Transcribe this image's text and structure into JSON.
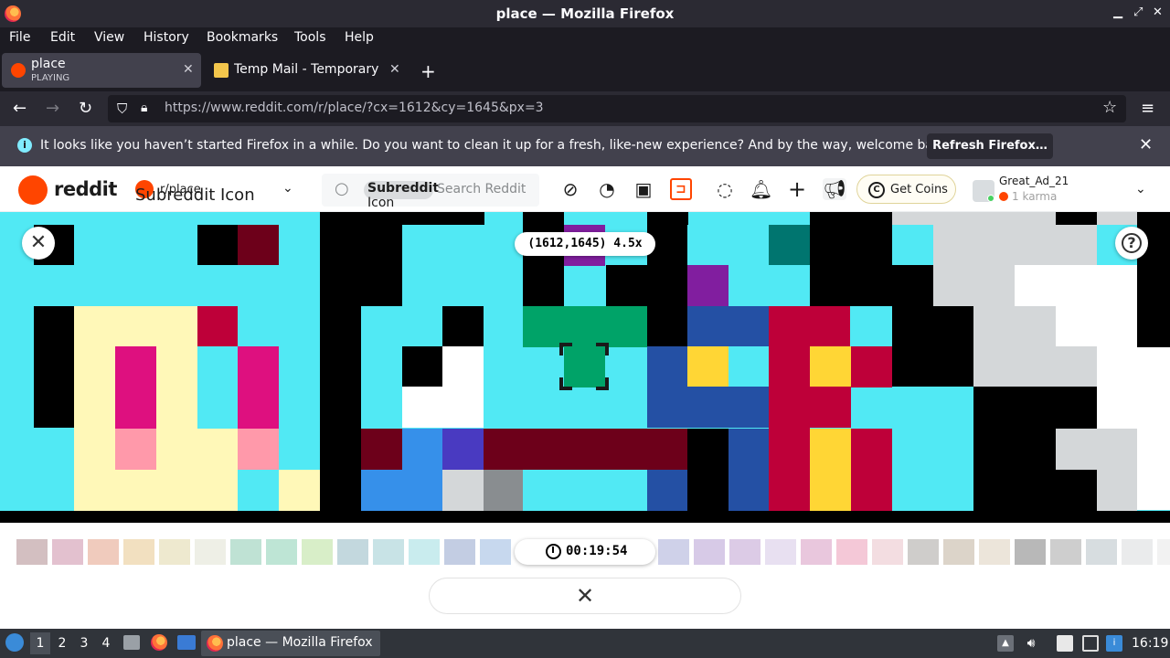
{
  "window": {
    "title": "place — Mozilla Firefox"
  },
  "menu": [
    "File",
    "Edit",
    "View",
    "History",
    "Bookmarks",
    "Tools",
    "Help"
  ],
  "tabs": [
    {
      "title": "place",
      "subtitle": "PLAYING"
    },
    {
      "title": "Temp Mail - Temporary D"
    }
  ],
  "navbar": {
    "url": "https://www.reddit.com/r/place/?cx=1612&cy=1645&px=3"
  },
  "notification": {
    "message": "It looks like you haven’t started Firefox in a while. Do you want to clean it up for a fresh, like-new experience? And by the way, welcome back!",
    "button": "Refresh Firefox…"
  },
  "reddit": {
    "logo_text": "reddit",
    "subreddit_icon_alt": "Subreddit Icon",
    "subreddit": "r/place",
    "search_chip": "Subreddit",
    "search_chip_line2": "Icon",
    "search_placeholder": "Search Reddit",
    "get_coins": "Get Coins",
    "username": "Great_Ad_21",
    "karma": "1 karma"
  },
  "place": {
    "coordinates": "(1612,1645) 4.5x",
    "timer": "00:19:54",
    "help_label": "?",
    "colors": {
      "cyan": "#51e9f4",
      "black": "#000000",
      "cream": "#fff8b8",
      "pink": "#de107f",
      "lightpink": "#ff99aa",
      "crimson": "#be0039",
      "maroon": "#6d001a",
      "green": "#00a368",
      "blue": "#2450a4",
      "brightblue": "#3690ea",
      "purple": "#811e9f",
      "indigo": "#493ac1",
      "yellow": "#ffd635",
      "white": "#ffffff",
      "lightgray": "#d4d7d9",
      "gray": "#898d90",
      "teal": "#00756f",
      "darkmagenta": "#6a1b50"
    },
    "palette": [
      "#d3bfc1",
      "#e3c1cf",
      "#f0cbbd",
      "#f2e0c0",
      "#eee9cf",
      "#eeefe6",
      "#bfe2d4",
      "#bee5d5",
      "#d8eec8",
      "#c3d8de",
      "#c8e3e6",
      "#c9ecee",
      "#c3cde3",
      "#c7d8ee",
      "#cfd1e9",
      "#d7cae7",
      "#dccbe6",
      "#e8e0f1",
      "#e9c7dd",
      "#f4c8d7",
      "#f3dde1",
      "#cfcdcb",
      "#dcd4c9",
      "#ece5da",
      "#b8b8b8",
      "#cecece",
      "#d7dde0",
      "#eaebec",
      "#f2f2f2"
    ]
  },
  "taskbar": {
    "workspaces": [
      "1",
      "2",
      "3",
      "4"
    ],
    "task_label": "place — Mozilla Firefox",
    "clock": "16:19"
  }
}
